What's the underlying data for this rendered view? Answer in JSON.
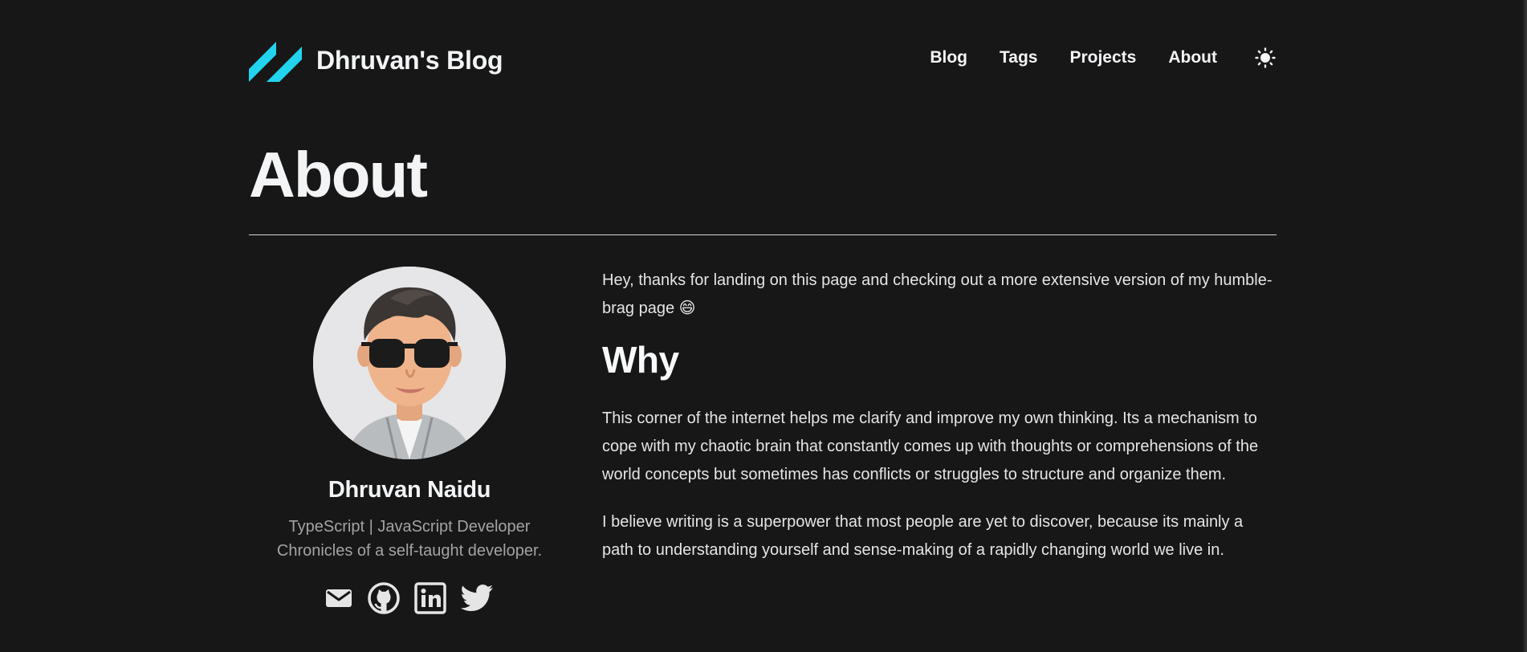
{
  "header": {
    "site_title": "Dhruvan's Blog",
    "nav": [
      {
        "label": "Blog"
      },
      {
        "label": "Tags"
      },
      {
        "label": "Projects"
      },
      {
        "label": "About"
      }
    ],
    "theme_toggle_icon": "sun-icon"
  },
  "page": {
    "title": "About"
  },
  "profile": {
    "name": "Dhruvan Naidu",
    "role": "TypeScript | JavaScript Developer",
    "tagline": "Chronicles of a self-taught developer.",
    "social_icons": [
      "mail-icon",
      "github-icon",
      "linkedin-icon",
      "twitter-icon"
    ]
  },
  "content": {
    "intro": "Hey, thanks for landing on this page and checking out a more extensive version of my humble-brag page 😄",
    "heading_why": "Why",
    "paragraph_1": "This corner of the internet helps me clarify and improve my own thinking. Its a mechanism to cope with my chaotic brain that constantly comes up with thoughts or comprehensions of the world concepts but sometimes has conflicts or struggles to structure and organize them.",
    "paragraph_2": "I believe writing is a superpower that most people are yet to discover, because its mainly a path to understanding yourself and sense-making of a rapidly changing world we live in."
  },
  "colors": {
    "background": "#171717",
    "logo_accent": "#22d3ee",
    "text_primary": "#f3f4f6",
    "text_muted": "#a3a3a3"
  }
}
